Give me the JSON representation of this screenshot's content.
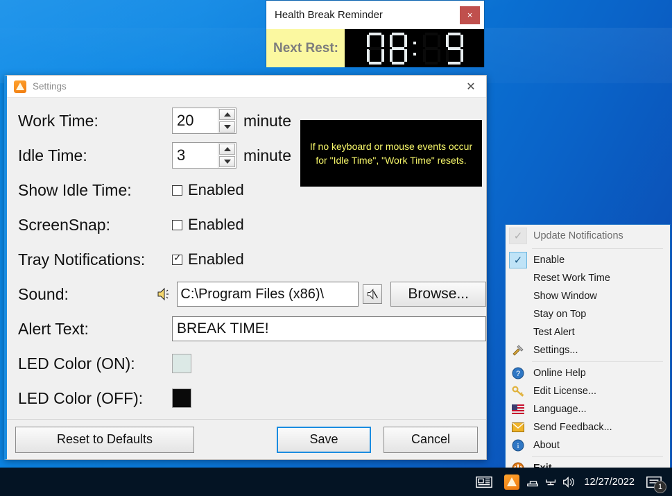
{
  "desktop": {
    "background_top": "#0a8ae8",
    "background_bottom": "#0c4aae"
  },
  "reminder": {
    "title": "Health Break Reminder",
    "close_label": "×",
    "next_rest_label": "Next Rest:",
    "led_value": "08:09",
    "led_digits": [
      "0",
      "8",
      ":",
      "0",
      "9"
    ],
    "led_dim_digits": [
      3
    ],
    "label_bg": "#fbf8a0",
    "led_bg": "#000000",
    "led_on_color": "#e8eef0",
    "close_bg": "#c0504d"
  },
  "settings": {
    "window_title": "Settings",
    "close_label": "✕",
    "info_note": "If no keyboard or mouse events occur for \"Idle Time\", \"Work Time\" resets.",
    "info_note_color": "#f7f76a",
    "rows": {
      "work_time": {
        "label": "Work Time:",
        "value": "20",
        "unit": "minute"
      },
      "idle_time": {
        "label": "Idle Time:",
        "value": "3",
        "unit": "minute"
      },
      "show_idle_time": {
        "label": "Show Idle Time:",
        "check_label": "Enabled",
        "checked": false
      },
      "screen_snap": {
        "label": "ScreenSnap:",
        "check_label": "Enabled",
        "checked": false
      },
      "tray_notifications": {
        "label": "Tray Notifications:",
        "check_label": "Enabled",
        "checked": true
      },
      "sound": {
        "label": "Sound:",
        "value": "C:\\Program Files (x86)\\",
        "browse_label": "Browse..."
      },
      "alert_text": {
        "label": "Alert Text:",
        "value": "BREAK TIME!"
      },
      "led_on": {
        "label": "LED Color (ON):",
        "color": "#dce9e6"
      },
      "led_off": {
        "label": "LED Color (OFF):",
        "color": "#0a0a0a"
      }
    },
    "footer": {
      "reset_label": "Reset to Defaults",
      "save_label": "Save",
      "cancel_label": "Cancel",
      "accent": "#1a8ce0"
    }
  },
  "tray_menu": {
    "items": [
      {
        "label": "Update Notifications",
        "type": "header",
        "icon": "check-dim-icon"
      },
      {
        "label": "Enable",
        "type": "checked",
        "icon": "check-icon"
      },
      {
        "label": "Reset Work Time",
        "type": "item",
        "icon": ""
      },
      {
        "label": "Show Window",
        "type": "item",
        "icon": ""
      },
      {
        "label": "Stay on Top",
        "type": "item",
        "icon": ""
      },
      {
        "label": "Test Alert",
        "type": "item",
        "icon": ""
      },
      {
        "label": "Settings...",
        "type": "item",
        "icon": "tools-icon"
      },
      {
        "label": "Online Help",
        "type": "item",
        "icon": "help-icon"
      },
      {
        "label": "Edit License...",
        "type": "item",
        "icon": "key-icon"
      },
      {
        "label": "Language...",
        "type": "item",
        "icon": "flag-icon"
      },
      {
        "label": "Send Feedback...",
        "type": "item",
        "icon": "mail-icon"
      },
      {
        "label": "About",
        "type": "item",
        "icon": "info-icon"
      },
      {
        "label": "Exit",
        "type": "bold",
        "icon": "power-icon"
      }
    ]
  },
  "taskbar": {
    "date": "12/27/2022",
    "notification_count": "1",
    "background": "#041424"
  }
}
